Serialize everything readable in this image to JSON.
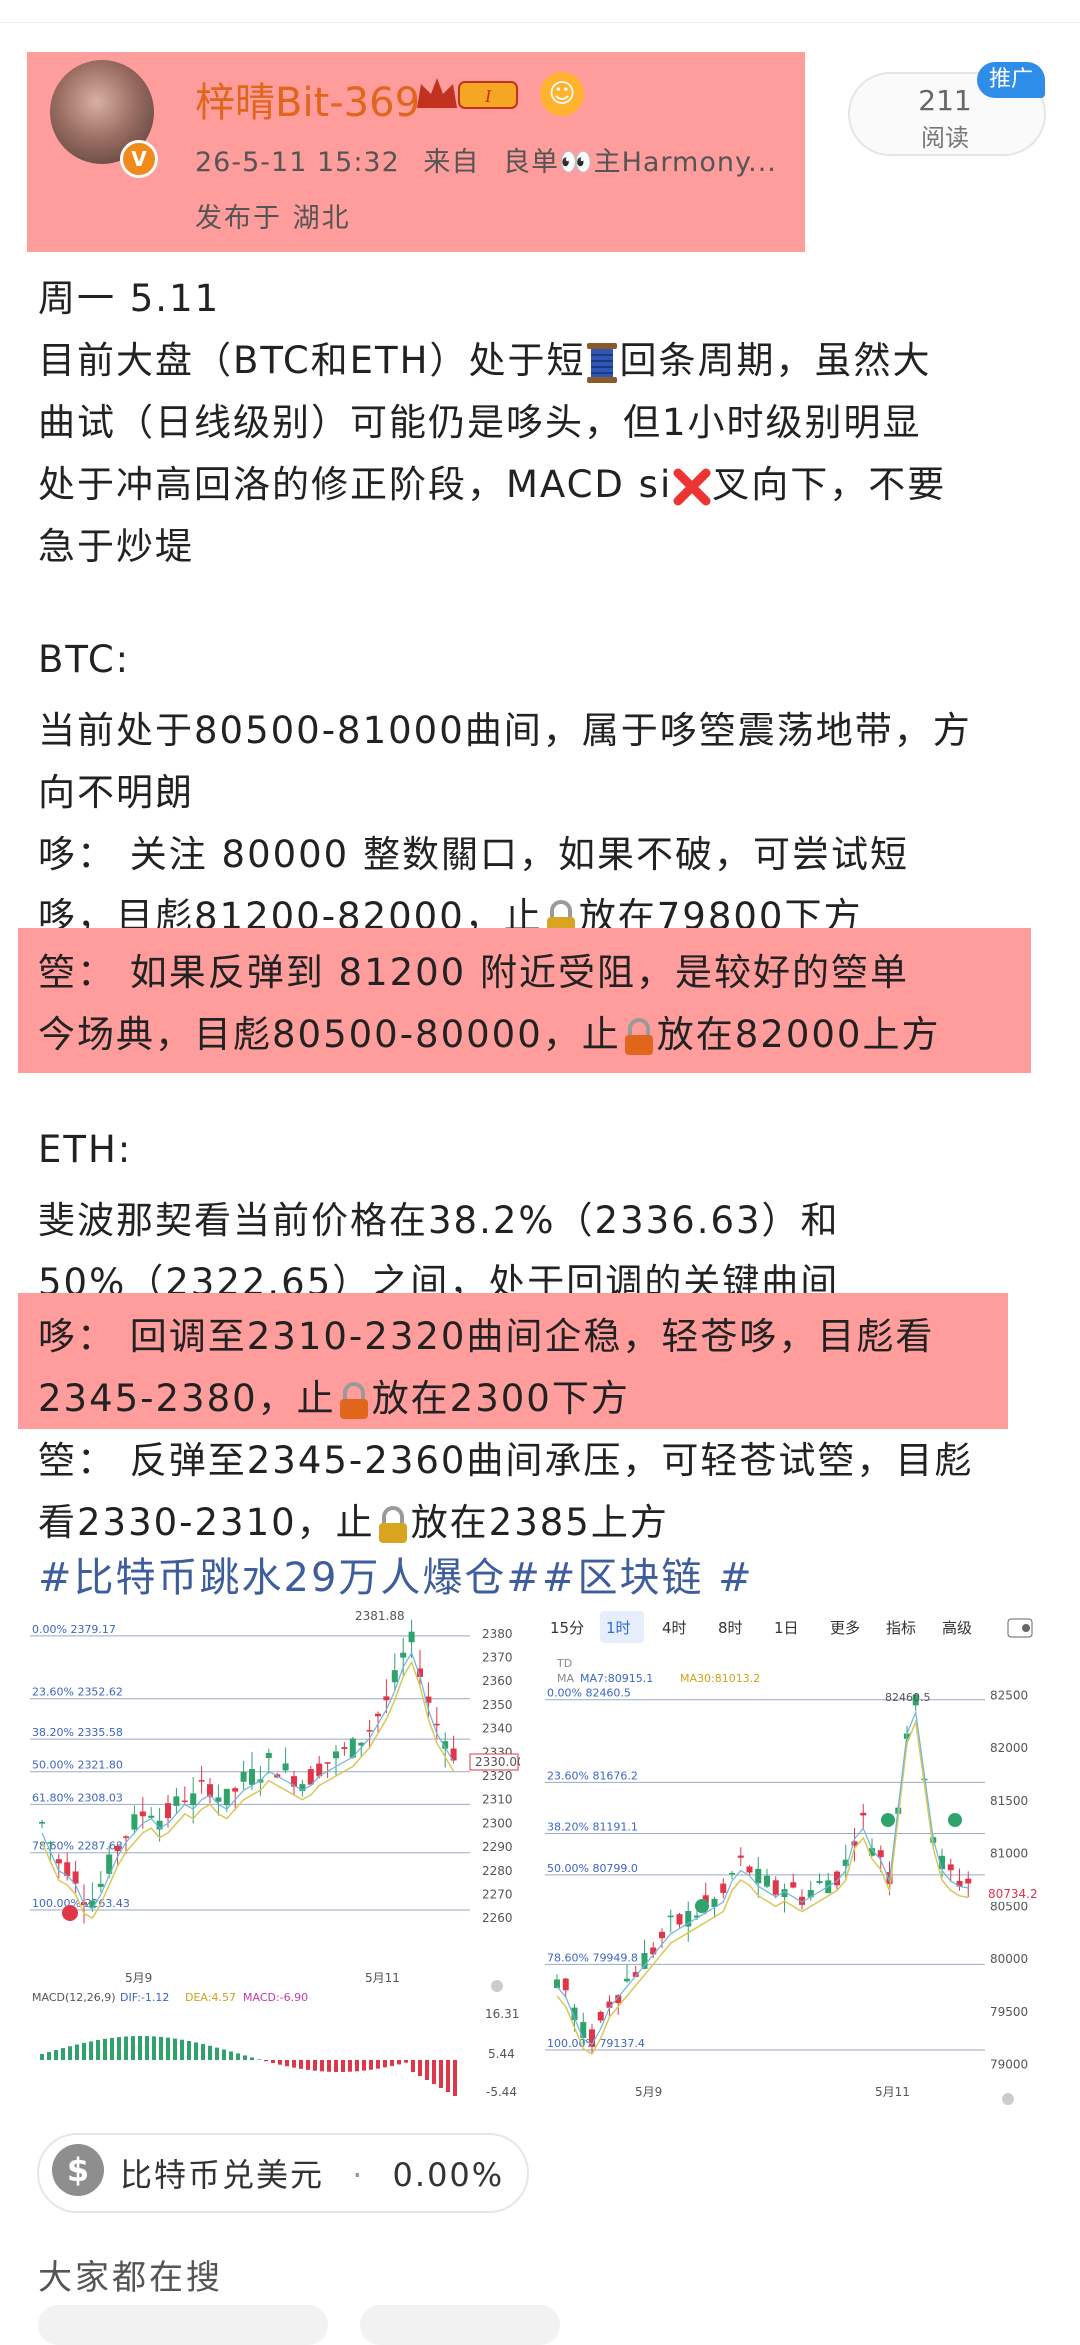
{
  "post": {
    "author": "梓晴Bit-369",
    "level_badge": "I",
    "datetime": "26-5-11 15:32",
    "source_prefix": "来自",
    "source": "良单👀主Harmony...",
    "location": "发布于 湖北",
    "read_count": "211",
    "read_label": "阅读",
    "promo_label": "推广"
  },
  "body": {
    "l1": "周一 5.11",
    "l2": "目前大盘（BTC和ETH）处于短",
    "l2b": "回条周期，虽然大",
    "l3": "曲试（日线级别）可能仍是哆头，但1小时级别明显",
    "l4": "处于冲高回洛的修正阶段，MACD si",
    "l4b": "叉向下，不要",
    "l5": "急于炒堤",
    "l6": "BTC:",
    "l7": "当前处于80500-81000曲间，属于哆箜震荡地带，方",
    "l8": "向不明朗",
    "l9": "哆： 关注 80000 整数關口，如果不破，可尝试短",
    "l10": "哆，目彪81200-82000，止",
    "l10b": "放在79800下方",
    "l11": "箜： 如果反弹到 81200 附近受阻，是较好的箜单",
    "l12": "今场典，目彪80500-80000，止",
    "l12b": "放在82000上方",
    "l13": "ETH:",
    "l14": "斐波那契看当前价格在38.2%（2336.63）和",
    "l15": "50%（2322.65）之间，处于回调的关键曲间",
    "l16": "哆： 回调至2310-2320曲间企稳，轻苍哆，目彪看",
    "l17": "2345-2380，止",
    "l17b": "放在2300下方",
    "l18": "箜： 反弹至2345-2360曲间承压，可轻苍试箜，目彪",
    "l19": "看2330-2310，止",
    "l19b": "放在2385上方"
  },
  "hashtags": "#比特币跳水29万人爆仓##区块链 #",
  "chart_left": {
    "price_ticks": [
      "2380",
      "2370",
      "2360",
      "2350",
      "2340",
      "2330",
      "2320",
      "2310",
      "2300",
      "2290",
      "2280",
      "2270",
      "2260"
    ],
    "current_price": "2330.00",
    "high_label": "2381.88",
    "fib_levels": [
      "0.00% 2379.17",
      "23.60% 2352.62",
      "38.20% 2335.58",
      "50.00% 2321.80",
      "61.80% 2308.03",
      "78.60% 2287.63",
      "100.00% 2263.43"
    ],
    "date_labels": [
      "5月9",
      "5月11"
    ],
    "macd_label": "MACD(12,26,9)",
    "macd_dif": "DIF:-1.12",
    "macd_dea": "DEA:4.57",
    "macd_macd": "MACD:-6.90",
    "macd_ticks": [
      "16.31",
      "5.44",
      "-5.44"
    ]
  },
  "chart_right": {
    "tabs": [
      "15分",
      "1时",
      "4时",
      "8时",
      "1日",
      "更多",
      "指标",
      "高级"
    ],
    "active_tab": "1时",
    "ma_label": "MA",
    "ma7": "MA7:80915.1",
    "ma30": "MA30:81013.2",
    "td_label": "TD",
    "high_label": "82460.5",
    "price_ticks": [
      "82500",
      "82000",
      "81500",
      "81000",
      "80500",
      "80000",
      "79500",
      "79000"
    ],
    "current_price": "80734.2",
    "fib_levels": [
      "0.00% 82460.5",
      "23.60% 81676.2",
      "38.20% 81191.1",
      "50.00% 80799.0",
      "78.60% 79949.8",
      "100.00% 79137.4"
    ],
    "date_labels": [
      "5月9",
      "5月11"
    ]
  },
  "ticker": {
    "name": "比特币兑美元",
    "dot": "·",
    "change": "0.00%"
  },
  "section": {
    "title": "大家都在搜"
  },
  "colors": {
    "highlight": "#ff9c9c",
    "up": "#2fa36b",
    "down": "#e0364a",
    "hashtag": "#3d5d9c",
    "username": "#e0661c"
  }
}
